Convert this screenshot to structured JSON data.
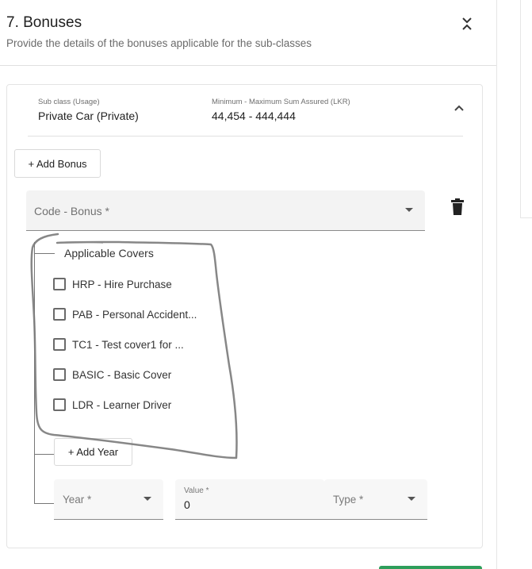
{
  "header": {
    "title": "7. Bonuses",
    "subtitle": "Provide the details of the bonuses applicable for the sub-classes"
  },
  "subclass": {
    "usage_label": "Sub class (Usage)",
    "usage_value": "Private Car (Private)",
    "sum_label": "Minimum - Maximum Sum Assured (LKR)",
    "sum_value": "44,454 - 444,444"
  },
  "actions": {
    "add_bonus": "+ Add Bonus",
    "add_year": "+ Add Year"
  },
  "bonus_select": {
    "placeholder": "Code - Bonus *"
  },
  "covers": {
    "title": "Applicable Covers",
    "items": [
      {
        "label": "HRP - Hire Purchase",
        "checked": false
      },
      {
        "label": "PAB - Personal Accident...",
        "checked": false
      },
      {
        "label": "TC1 - Test cover1 for ...",
        "checked": false
      },
      {
        "label": "BASIC - Basic Cover",
        "checked": false
      },
      {
        "label": "LDR - Learner Driver",
        "checked": false
      }
    ]
  },
  "year_row": {
    "year_placeholder": "Year *",
    "value_label": "Value *",
    "value_value": "0",
    "type_placeholder": "Type *"
  },
  "icons": {
    "collapse": "collapse-vertical-icon",
    "expand": "chevron-up-icon",
    "delete": "trash-icon",
    "dropdown": "caret-down-icon"
  },
  "colors": {
    "annotation": "#7a7a7a",
    "accent": "#2e9e5b"
  }
}
